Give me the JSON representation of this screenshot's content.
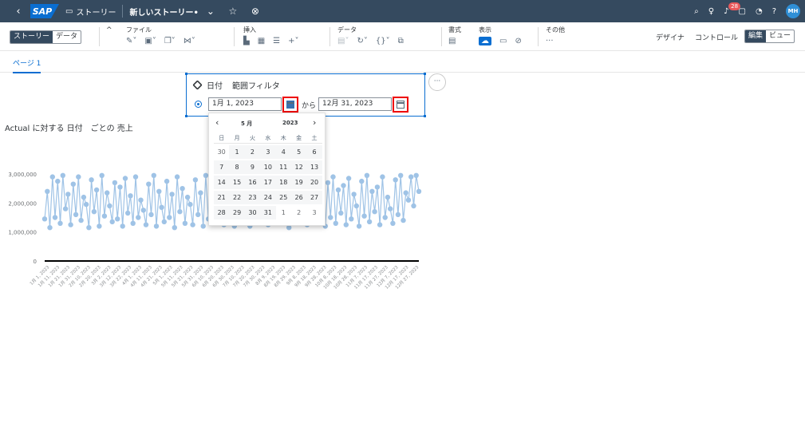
{
  "shell": {
    "story_label": "ストーリー",
    "title": "新しいストーリー•",
    "notification_count": "28",
    "avatar_initials": "MH"
  },
  "toolbar": {
    "mode_tabs": [
      "ストーリー",
      "データ"
    ],
    "groups": {
      "file": "ファイル",
      "insert": "挿入",
      "data": "データ",
      "format": "書式",
      "display": "表示",
      "other": "その他"
    },
    "designer": "デザイナ",
    "control": "コントロール",
    "edit": "編集",
    "view": "ビュー"
  },
  "page_tab": "ページ 1",
  "filter": {
    "dimension": "日付",
    "type": "範囲フィルタ",
    "from_value": "1月 1, 2023",
    "connector": "から",
    "to_value": "12月 31, 2023"
  },
  "calendar": {
    "month": "5 月",
    "year": "2023",
    "weekdays": [
      "日",
      "月",
      "火",
      "水",
      "木",
      "金",
      "土"
    ],
    "weeks": [
      [
        "30",
        "1",
        "2",
        "3",
        "4",
        "5",
        "6"
      ],
      [
        "7",
        "8",
        "9",
        "10",
        "11",
        "12",
        "13"
      ],
      [
        "14",
        "15",
        "16",
        "17",
        "18",
        "19",
        "20"
      ],
      [
        "21",
        "22",
        "23",
        "24",
        "25",
        "26",
        "27"
      ],
      [
        "28",
        "29",
        "30",
        "31",
        "1",
        "2",
        "3"
      ]
    ]
  },
  "chart_data": {
    "type": "line",
    "title": "Actual に対する 日付　ごとの 売上",
    "ylim": [
      0,
      3000000
    ],
    "y_ticks": [
      "3,000,000",
      "2,000,000",
      "1,000,000",
      "0"
    ],
    "x_ticks": [
      "1月 1, 2023",
      "1月 11, 2023",
      "1月 21, 2023",
      "1月 31, 2023",
      "2月 10, 2023",
      "2月 20, 2023",
      "3月 2, 2023",
      "3月 12, 2023",
      "3月 22, 2023",
      "4月 1, 2023",
      "4月 11, 2023",
      "4月 21, 2023",
      "5月 1, 2023",
      "5月 11, 2023",
      "5月 21, 2023",
      "5月 31, 2023",
      "6月 10, 2023",
      "6月 20, 2023",
      "6月 30, 2023",
      "7月 10, 2023",
      "7月 20, 2023",
      "7月 30, 2023",
      "8月 9, 2023",
      "8月 19, 2023",
      "8月 29, 2023",
      "9月 8, 2023",
      "9月 18, 2023",
      "9月 28, 2023",
      "10月 8, 2023",
      "10月 18, 2023",
      "10月 28, 2023",
      "11月 7, 2023",
      "11月 17, 2023",
      "11月 27, 2023",
      "12月 7, 2023",
      "12月 17, 2023",
      "12月 27, 2023"
    ],
    "series": [
      {
        "color": "#9fc3e6",
        "values": [
          1450000,
          2400000,
          1150000,
          2900000,
          1500000,
          2750000,
          1300000,
          2950000,
          1800000,
          2300000,
          1250000,
          2650000,
          1600000,
          2900000,
          1400000,
          2200000,
          1950000,
          1150000,
          2800000,
          1700000,
          2450000,
          1200000,
          2950000,
          1550000,
          2350000,
          1900000,
          1350000,
          2700000,
          1450000,
          2550000,
          1200000,
          2850000,
          1650000,
          2250000,
          1300000,
          2900000,
          1500000,
          2100000,
          1750000,
          1250000,
          2650000,
          1600000,
          2950000,
          1200000,
          2400000,
          1850000,
          1350000,
          2750000,
          1500000,
          2300000,
          1150000,
          2900000,
          1700000,
          2500000,
          1300000,
          2200000,
          1950000,
          1250000,
          2800000,
          1600000,
          2350000,
          1200000,
          2950000,
          1450000,
          2600000,
          1350000,
          2850000,
          1750000,
          2150000,
          1250000,
          2700000,
          1550000,
          2450000,
          1200000,
          2900000,
          1650000,
          2300000,
          1400000,
          2850000,
          1200000,
          2550000,
          1800000,
          1300000,
          2750000,
          1500000,
          2950000,
          1250000,
          2400000,
          1700000,
          2200000,
          1350000,
          2850000,
          1600000,
          2500000,
          1150000,
          2900000,
          1450000,
          2650000,
          1300000,
          2350000,
          1850000,
          1250000,
          2800000,
          1550000,
          2950000,
          1400000,
          2250000,
          1750000,
          1200000,
          2700000,
          1500000,
          2900000,
          1300000,
          2450000,
          1650000,
          2600000,
          1250000,
          2850000,
          1450000,
          2300000,
          1900000,
          1200000,
          2750000,
          1550000,
          2950000,
          1350000,
          2400000,
          1700000,
          2550000,
          1250000,
          2900000,
          1500000,
          2200000,
          1800000,
          1300000,
          2800000,
          1600000,
          2950000,
          1400000,
          2350000,
          2100000,
          2900000,
          1900000,
          2950000,
          2400000
        ]
      }
    ]
  }
}
